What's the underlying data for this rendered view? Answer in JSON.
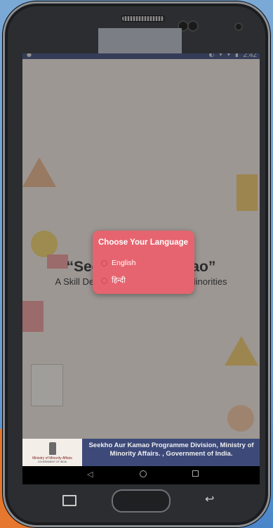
{
  "status_bar": {
    "time": "2:42",
    "icons": "◐ ▾ ▾ ▮"
  },
  "hero": {
    "title": "“Seekho Aur Kamao”",
    "subtitle": "A Skill Development Scheme for Minorities"
  },
  "footer": {
    "logo_title": "Ministry of Minority Affairs",
    "logo_subtitle": "GOVERNMENT OF INDIA",
    "text": "Seekho Aur Kamao Programme Division, Ministry of Minority Affairs. , Government of India."
  },
  "dialog": {
    "title": "Choose Your Language",
    "options": [
      {
        "label": "English",
        "selected": false
      },
      {
        "label": "हिन्दी",
        "selected": false
      }
    ]
  },
  "colors": {
    "dialog_bg": "#e6646f",
    "footer_bg": "#3d4a79",
    "status_bar_bg": "#3f4a7a"
  }
}
